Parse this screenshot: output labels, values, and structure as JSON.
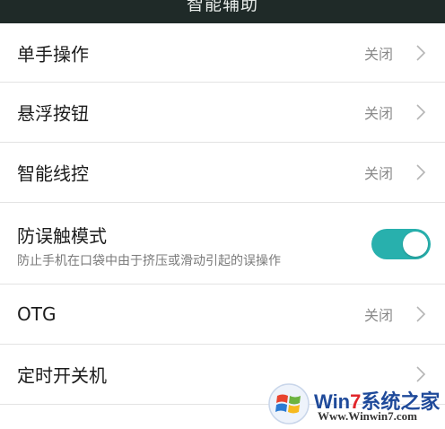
{
  "header": {
    "title": "智能辅助"
  },
  "settings": {
    "one_hand": {
      "label": "单手操作",
      "value": "关闭"
    },
    "float_button": {
      "label": "悬浮按钮",
      "value": "关闭"
    },
    "smart_control": {
      "label": "智能线控",
      "value": "关闭"
    },
    "anti_touch": {
      "label": "防误触模式",
      "description": "防止手机在口袋中由于挤压或滑动引起的误操作",
      "enabled": true
    },
    "otg": {
      "label": "OTG",
      "value": "关闭"
    },
    "scheduled_power": {
      "label": "定时开关机"
    }
  },
  "watermark": {
    "brand_part1": "Win",
    "brand_part2": "7",
    "brand_part3": "系统之家",
    "url": "Www.Winwin7.com"
  },
  "colors": {
    "toggle_on": "#28b0ad",
    "topbar": "#1f2a28"
  }
}
